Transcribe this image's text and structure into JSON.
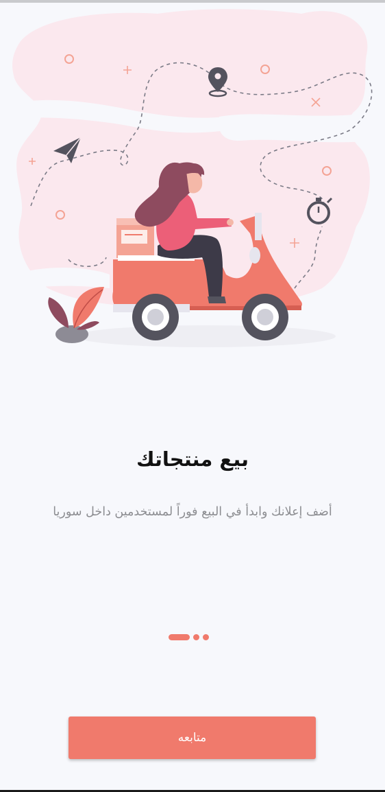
{
  "onboarding": {
    "illustration_icon": "delivery-scooter-illustration",
    "title": "بيع منتجاتك",
    "subtitle": "أضف إعلانك وابدأ في البيع فوراً لمستخدمين داخل سوريا",
    "pager": {
      "total": 3,
      "current": 1
    },
    "continue_label": "متابعه"
  },
  "colors": {
    "accent": "#f07a6c",
    "background": "#f7f8fc",
    "title": "#111111",
    "subtitle": "#8c8d91",
    "blob": "#fbe7ec",
    "hair": "#8e4b5f",
    "dark_gray": "#54535e"
  }
}
